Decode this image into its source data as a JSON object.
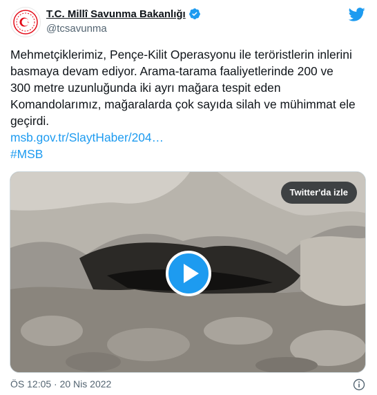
{
  "header": {
    "display_name": "T.C. Millî Savunma Bakanlığı",
    "handle": "@tcsavunma",
    "avatar_icon": "turkish-flag-emblem-icon",
    "verified_icon": "verified-badge-icon",
    "brand_icon": "twitter-bird-icon"
  },
  "tweet": {
    "text": "Mehmetçiklerimiz, Pençe-Kilit Operasyonu ile teröristlerin inlerini basmaya devam ediyor. Arama-tarama faaliyetlerinde 200 ve 300 metre uzunluğunda iki ayrı mağara tespit eden Komandolarımız, mağaralarda çok sayıda silah ve mühimmat ele geçirdi.",
    "link": "msb.gov.tr/SlaytHaber/204…",
    "hashtag": "#MSB"
  },
  "media": {
    "watch_label": "Twitter'da izle",
    "play_icon": "play-icon"
  },
  "footer": {
    "timestamp": "ÖS 12:05 · 20 Nis 2022",
    "info_icon": "info-icon"
  },
  "colors": {
    "accent": "#1d9bf0",
    "text": "#0f1419",
    "muted": "#536471",
    "flag_red": "#e30a17"
  }
}
